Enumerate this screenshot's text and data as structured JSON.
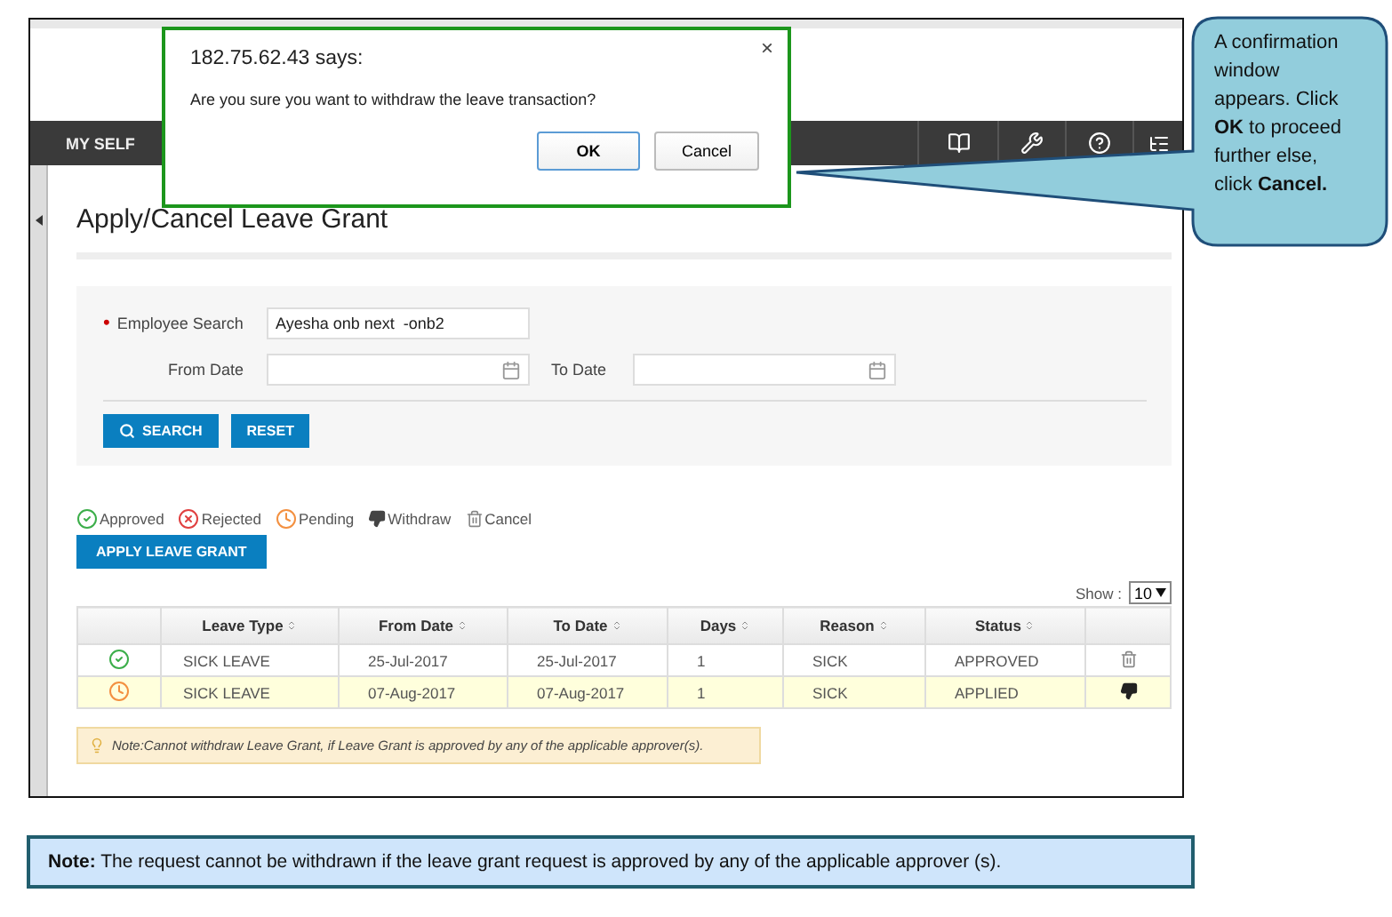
{
  "browser_dialog": {
    "title": "182.75.62.43 says:",
    "close": "×",
    "message": "Are you sure you want to withdraw the leave transaction?",
    "buttons": [
      {
        "label": "OK",
        "focused": true
      },
      {
        "label": "Cancel",
        "focused": false
      }
    ]
  },
  "callout": {
    "text": "A confirmation window appears. Click **OK** to proceed further else, click **Cancel.**"
  },
  "nav_bar": {
    "menu": "MY SELF"
  },
  "page": {
    "title": "Apply/Cancel Leave Grant"
  },
  "search_form": {
    "employee_search": {
      "label": "Employee Search",
      "required_mark": "•",
      "value": "Ayesha onb next  -onb2"
    },
    "from_date": {
      "label": "From Date"
    },
    "to_date": {
      "label": "To Date"
    },
    "buttons": [
      {
        "kind": "search",
        "label": "SEARCH"
      },
      {
        "kind": "reset",
        "label": "RESET"
      }
    ]
  },
  "legend": [
    {
      "kind": "approved",
      "label": "Approved"
    },
    {
      "kind": "rejected",
      "label": "Rejected"
    },
    {
      "kind": "pending",
      "label": "Pending"
    },
    {
      "kind": "withdraw",
      "label": "Withdraw"
    },
    {
      "kind": "cancel",
      "label": "Cancel"
    }
  ],
  "apply_button": "APPLY LEAVE GRANT",
  "show": {
    "label": "Show :",
    "value": "10"
  },
  "table": {
    "columns": [
      "Leave Type",
      "From Date",
      "To Date",
      "Days",
      "Reason",
      "Status"
    ],
    "rows": [
      {
        "status_icon": {
          "kind": "approved"
        },
        "cells": [
          "SICK LEAVE",
          "25-Jul-2017",
          "25-Jul-2017",
          "1",
          "SICK",
          "APPROVED"
        ],
        "action": {
          "kind": "cancel"
        },
        "selected": false
      },
      {
        "status_icon": {
          "kind": "pending"
        },
        "cells": [
          "SICK LEAVE",
          "07-Aug-2017",
          "07-Aug-2017",
          "1",
          "SICK",
          "APPLIED"
        ],
        "action": {
          "kind": "withdraw"
        },
        "selected": true
      }
    ]
  },
  "inline_note": "Note:Cannot withdraw Leave Grant, if Leave Grant is approved by any of the applicable approver(s).",
  "footer_note": "**Note:** The request cannot be withdrawn if the leave grant request is approved by any of the applicable approver (s)."
}
